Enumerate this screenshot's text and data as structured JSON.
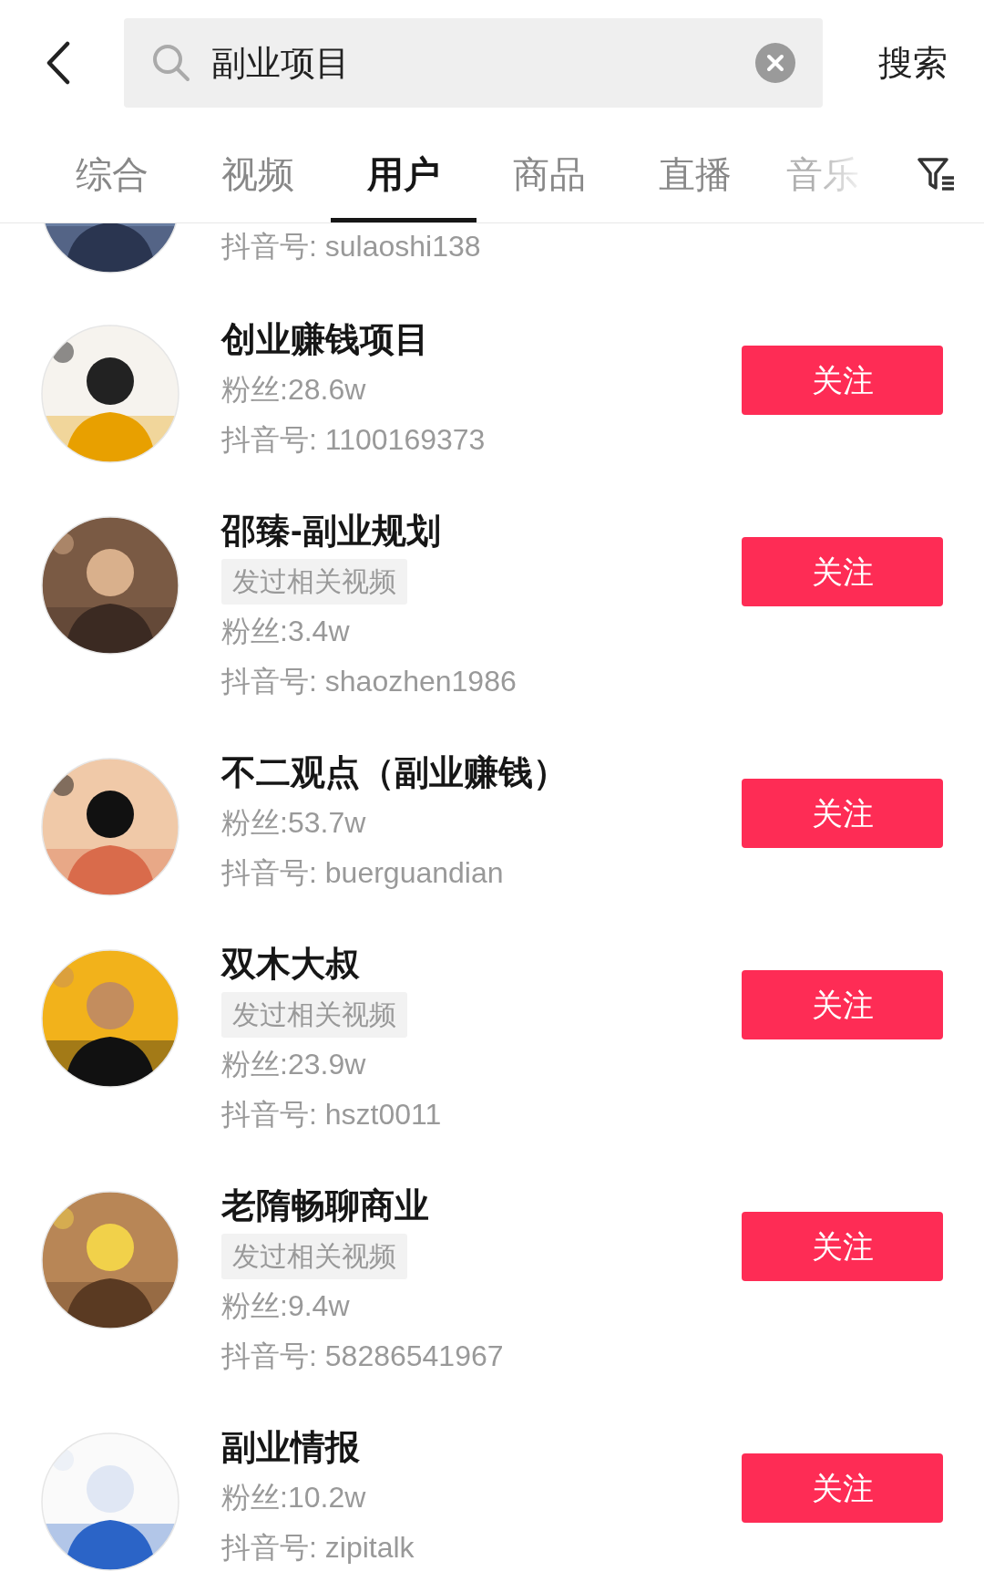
{
  "search": {
    "query": "副业项目",
    "submit": "搜索"
  },
  "tabs": [
    {
      "label": "综合",
      "selected": false
    },
    {
      "label": "视频",
      "selected": false
    },
    {
      "label": "用户",
      "selected": true
    },
    {
      "label": "商品",
      "selected": false
    },
    {
      "label": "直播",
      "selected": false
    },
    {
      "label": "音乐",
      "selected": false
    }
  ],
  "users": [
    {
      "partial": true,
      "douyin_id": "抖音号: sulaoshi138"
    },
    {
      "partial": false,
      "name": "创业赚钱项目",
      "fans": "粉丝:28.6w",
      "douyin_id": "抖音号: 1100169373",
      "follow": "关注"
    },
    {
      "partial": false,
      "name": "邵臻-副业规划",
      "tag": "发过相关视频",
      "fans": "粉丝:3.4w",
      "douyin_id": "抖音号: shaozhen1986",
      "follow": "关注"
    },
    {
      "partial": false,
      "name": "不二观点（副业赚钱）",
      "fans": "粉丝:53.7w",
      "douyin_id": "抖音号: buerguandian",
      "follow": "关注"
    },
    {
      "partial": false,
      "name": "双木大叔",
      "tag": "发过相关视频",
      "fans": "粉丝:23.9w",
      "douyin_id": "抖音号: hszt0011",
      "follow": "关注"
    },
    {
      "partial": false,
      "name": "老隋畅聊商业",
      "tag": "发过相关视频",
      "fans": "粉丝:9.4w",
      "douyin_id": "抖音号: 58286541967",
      "follow": "关注"
    },
    {
      "partial": false,
      "name": "副业情报",
      "fans": "粉丝:10.2w",
      "douyin_id": "抖音号: zipitalk",
      "follow": "关注"
    }
  ]
}
